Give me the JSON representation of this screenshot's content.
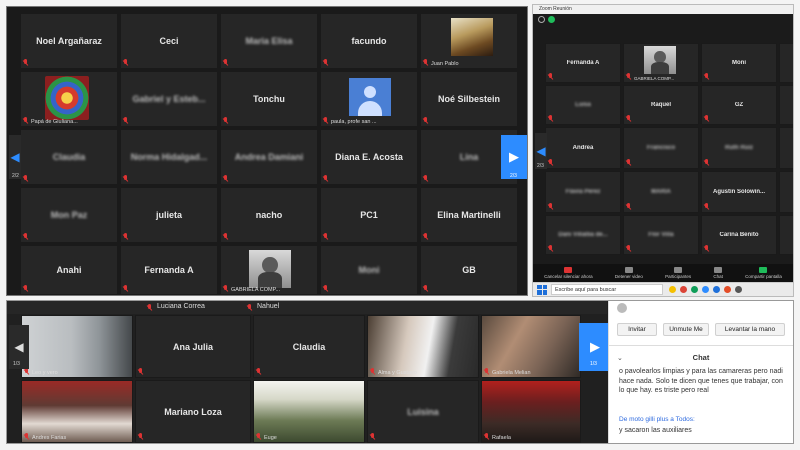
{
  "panel1": {
    "page_left": "2/2",
    "page_right": "2/3",
    "tiles": [
      {
        "name": "Noel Argañaraz"
      },
      {
        "name": "Ceci"
      },
      {
        "name": "Maria Elisa"
      },
      {
        "name": "facundo"
      },
      {
        "label": "Juan Pablo"
      },
      {
        "label": "Papá de Giuliana..."
      },
      {
        "name": "Gabriel y Esteb..."
      },
      {
        "name": "Tonchu"
      },
      {
        "label": "paula, profe san ..."
      },
      {
        "name": "Noé Silbestein"
      },
      {
        "name": "Claudia"
      },
      {
        "name": "Norma Hidalgad..."
      },
      {
        "name": "Andrea Damiani"
      },
      {
        "name": "Diana E. Acosta"
      },
      {
        "name": "Lina"
      },
      {
        "name": "Mon Paz"
      },
      {
        "name": "julieta"
      },
      {
        "name": "nacho"
      },
      {
        "name": "PC1"
      },
      {
        "name": "Elina Martinelli"
      },
      {
        "name": "Anahi"
      },
      {
        "name": "Fernanda A"
      },
      {
        "label": "GABRIELA COMP..."
      },
      {
        "name": "Moni"
      },
      {
        "name": "GB"
      }
    ]
  },
  "panel2": {
    "window_title": "Zoom Reunión",
    "page_left": "2/3",
    "tiles": [
      {
        "name": "Fernanda A"
      },
      {
        "label": "GABRIELA COMP..."
      },
      {
        "name": "Moni"
      },
      {
        "name": "Luisa"
      },
      {
        "name": "Raquel"
      },
      {
        "name": "GZ"
      },
      {
        "name": "Andrea"
      },
      {
        "name": "Francisco"
      },
      {
        "name": "Ruth Ruiz"
      },
      {
        "name": "Flavia Perez"
      },
      {
        "name": "MARIA"
      },
      {
        "name": "Agustin Solowin..."
      },
      {
        "name": "Dani Villalba de..."
      },
      {
        "name": "Flor Villa"
      },
      {
        "name": "Carina Benito"
      }
    ],
    "toolbar": [
      {
        "label": "Cancelar silenciar ahora"
      },
      {
        "label": "Detener video"
      },
      {
        "label": "Participantes"
      },
      {
        "label": "Chat"
      },
      {
        "label": "Compartir pantalla"
      }
    ],
    "taskbar_search": "Escribe aquí para buscar"
  },
  "panel3": {
    "page_left": "1/3",
    "page_right": "1/3",
    "top_names": [
      "Luciana Correa",
      "Nahuel"
    ],
    "tiles": [
      {
        "label": "Leo y vero"
      },
      {
        "name": "Ana Julia"
      },
      {
        "name": "Claudia"
      },
      {
        "label": "Alma y Gustavo"
      },
      {
        "label": "Gabriela Melian"
      },
      {
        "label": "Andres Farias"
      },
      {
        "name": "Mariano Loza"
      },
      {
        "label": "Euge"
      },
      {
        "name": "Luisina"
      },
      {
        "label": "Rafaela"
      }
    ],
    "chat": {
      "buttons": [
        "Invitar",
        "Unmute Me",
        "Levantar la mano"
      ],
      "header": "Chat",
      "message": "o pavolearlos limpias y para las camareras pero nadi hace nada. Solo te dicen que tenes que trabajar, con lo que hay. es triste pero real",
      "from_line": "De moto gilli plus a Todos:",
      "last_line": "y sacaron las auxiliares"
    }
  },
  "colors": {
    "accent": "#2d8cff",
    "mic_muted": "#dd3333",
    "tile_bg": "#262626"
  }
}
